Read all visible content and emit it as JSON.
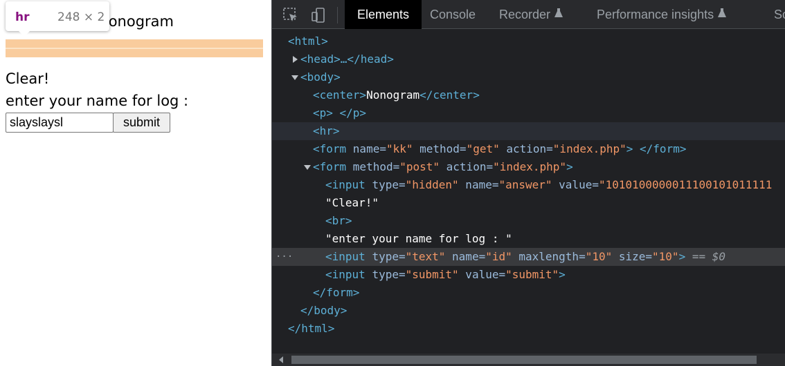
{
  "page": {
    "title": "Nonogram",
    "clear_text": "Clear!",
    "log_label": "enter your name for log :",
    "name_value": "slayslaysl",
    "submit_label": "submit"
  },
  "tooltip": {
    "tag": "hr",
    "dims": "248 × 2"
  },
  "devtools": {
    "tabs": [
      {
        "label": "Elements"
      },
      {
        "label": "Console"
      },
      {
        "label": "Recorder"
      },
      {
        "label": "Performance insights"
      },
      {
        "label": "Sour"
      }
    ],
    "dom": {
      "html_open": "<html>",
      "head": "<head>…</head>",
      "body_open": "<body>",
      "center_open": "<center>",
      "center_text": "Nonogram",
      "center_close": "</center>",
      "p": "<p> </p>",
      "hr": "<hr>",
      "form1_tag": "<form ",
      "form1_a1": "name=",
      "form1_v1": "\"kk\"",
      "form1_a2": " method=",
      "form1_v2": "\"get\"",
      "form1_a3": " action=",
      "form1_v3": "\"index.php\"",
      "form1_end": "> </form>",
      "form2_tag": "<form ",
      "form2_a1": "method=",
      "form2_v1": "\"post\"",
      "form2_a2": " action=",
      "form2_v2": "\"index.php\"",
      "form2_end": ">",
      "in1_tag": "<input ",
      "in1_a1": "type=",
      "in1_v1": "\"hidden\"",
      "in1_a2": " name=",
      "in1_v2": "\"answer\"",
      "in1_a3": " value=",
      "in1_v3": "\"1010100000011100101011111",
      "text_clear": "\"Clear!\"",
      "br": "<br>",
      "text_log": "\"enter your name for log : \"",
      "in2_tag": "<input ",
      "in2_a1": "type=",
      "in2_v1": "\"text\"",
      "in2_a2": " name=",
      "in2_v2": "\"id\"",
      "in2_a3": " maxlength=",
      "in2_v3": "\"10\"",
      "in2_a4": " size=",
      "in2_v4": "\"10\"",
      "in2_end": ">",
      "in2_eq": " == ",
      "in2_dollar": "$0",
      "in3_tag": "<input ",
      "in3_a1": "type=",
      "in3_v1": "\"submit\"",
      "in3_a2": " value=",
      "in3_v2": "\"submit\"",
      "in3_end": ">",
      "form_close": "</form>",
      "body_close": "</body>",
      "html_close": "</html>",
      "dots": "···"
    }
  }
}
